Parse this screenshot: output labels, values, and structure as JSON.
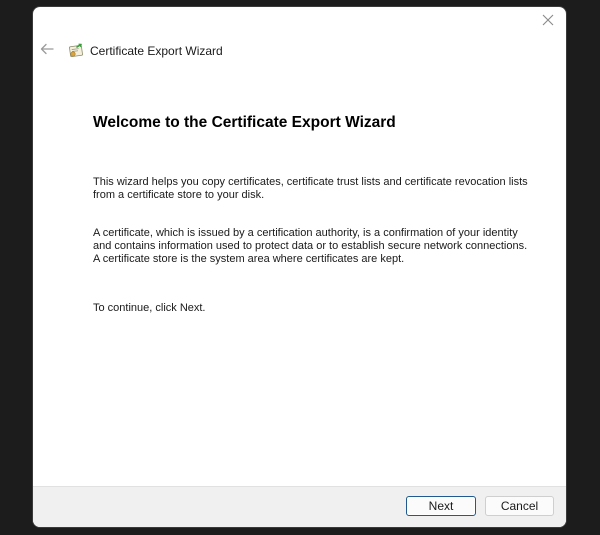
{
  "window": {
    "title": "Certificate Export Wizard",
    "close_icon": "close-icon",
    "back_icon": "back-arrow-icon",
    "wizard_icon": "certificate-icon"
  },
  "main": {
    "heading": "Welcome to the Certificate Export Wizard",
    "paragraph1": "This wizard helps you copy certificates, certificate trust lists and certificate revocation lists from a certificate store to your disk.",
    "paragraph2": "A certificate, which is issued by a certification authority, is a confirmation of your identity and contains information used to protect data or to establish secure network connections. A certificate store is the system area where certificates are kept.",
    "paragraph3": "To continue, click Next."
  },
  "footer": {
    "next_label": "Next",
    "cancel_label": "Cancel"
  },
  "colors": {
    "backdrop": "#1c1c1c",
    "dialog_bg": "#ffffff",
    "footer_bg": "#f0f0f0",
    "default_button_border": "#1e5a8f"
  }
}
